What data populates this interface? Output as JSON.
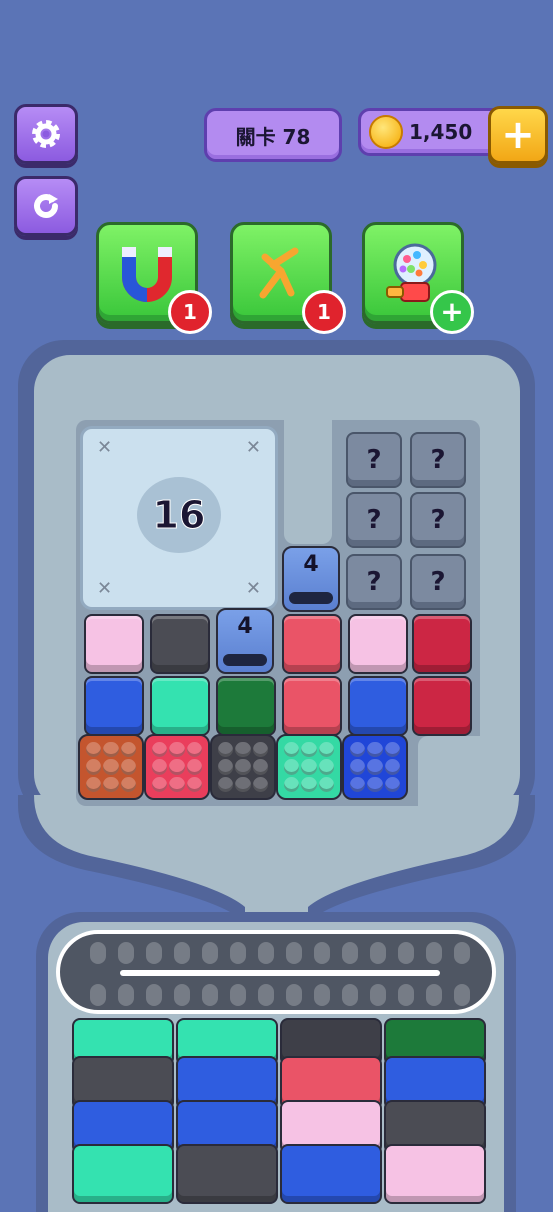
{
  "hud": {
    "level_label": "關卡 78",
    "coins": "1,450",
    "add_coins": "+"
  },
  "boosters": [
    {
      "name": "magnet",
      "count": "1"
    },
    {
      "name": "unscrew",
      "count": "1"
    },
    {
      "name": "gumball",
      "count": "+"
    }
  ],
  "locked_tile": {
    "value": "16"
  },
  "mystery_tiles": [
    "?",
    "?",
    "?",
    "?",
    "?",
    "?"
  ],
  "tunnels": [
    {
      "count": "4"
    },
    {
      "count": "4"
    }
  ],
  "colors": {
    "pink": "#f6c2e4",
    "charcoal": "#4b4c54",
    "red": "#ea5467",
    "crimson": "#cc2644",
    "blue": "#2f5de0",
    "mint": "#34e2b0",
    "green": "#1d7a3a",
    "orange": "#c4552e"
  }
}
